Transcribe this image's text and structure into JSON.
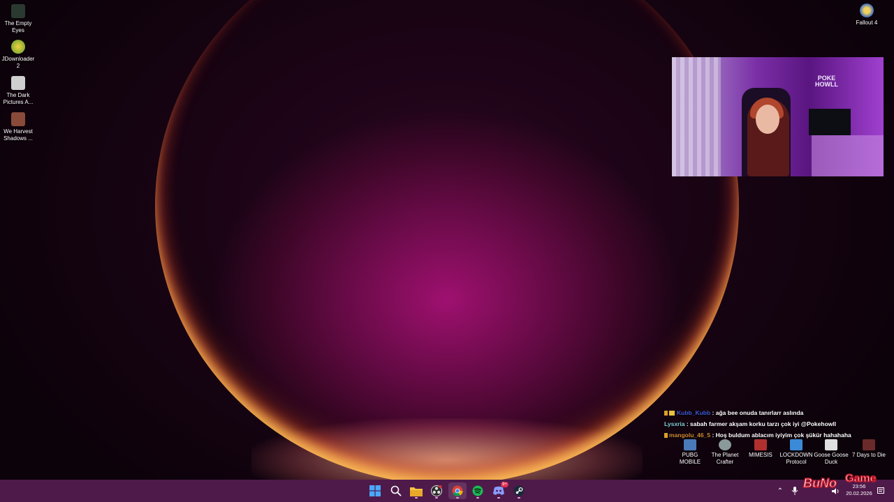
{
  "desktop": {
    "left_icons": [
      {
        "label_line1": "The Empty",
        "label_line2": "Eyes",
        "icon": "game-icon-empty-eyes",
        "color": "#2a3a30"
      },
      {
        "label_line1": "JDownloader",
        "label_line2": "2",
        "icon": "jdownloader-icon",
        "color": "#e0b020"
      },
      {
        "label_line1": "The Dark",
        "label_line2": "Pictures A...",
        "icon": "game-icon-dark-pictures",
        "color": "#cfcfcf"
      },
      {
        "label_line1": "We Harvest",
        "label_line2": "Shadows ...",
        "icon": "game-icon-we-harvest-shadows",
        "color": "#8a4a3a"
      }
    ],
    "right_icon": {
      "label": "Fallout 4",
      "icon": "fallout-4-icon",
      "color": "#3a6ac0"
    }
  },
  "webcam": {
    "sign_line1": "POKE",
    "sign_line2": "HOWLL"
  },
  "chat": {
    "messages": [
      {
        "user": "Kubb_Kubb",
        "user_color": "#3a5ad0",
        "text": ": ağa bee onuda tanırlarr aslında"
      },
      {
        "user": "Lysxria",
        "user_color": "#7fd0d8",
        "text": ": sabah farmer akşam korku tarzı çok iyi @Pokehowll"
      },
      {
        "user": "mangolu_46_5",
        "user_color": "#d08a30",
        "text": ": Hoş buldum ablacım iyiyim çok şükür hahahaha"
      }
    ]
  },
  "games": [
    {
      "line1": "PUBG",
      "line2": "MOBILE",
      "icon": "pubg-mobile-icon",
      "color": "#4a7ab8"
    },
    {
      "line1": "The Planet",
      "line2": "Crafter",
      "icon": "planet-crafter-icon",
      "color": "#8a9a9a"
    },
    {
      "line1": "MIMESIS",
      "line2": "",
      "icon": "mimesis-icon",
      "color": "#b03030"
    },
    {
      "line1": "LOCKDOWN",
      "line2": "Protocol",
      "icon": "lockdown-protocol-icon",
      "color": "#3a8ad8"
    },
    {
      "line1": "Goose Goose",
      "line2": "Duck",
      "icon": "goose-goose-duck-icon",
      "color": "#e0e0e0"
    },
    {
      "line1": "7 Days to Die",
      "line2": "",
      "icon": "7-days-to-die-icon",
      "color": "#6a2a2a"
    }
  ],
  "taskbar": {
    "apps": [
      {
        "name": "start-button",
        "glyph": "⊞",
        "color": "#4aa8ff"
      },
      {
        "name": "search-button",
        "glyph": "⌕",
        "color": "#ffffff"
      },
      {
        "name": "file-explorer-button",
        "glyph": "▰",
        "color": "#f5c542"
      },
      {
        "name": "obs-button",
        "glyph": "◉",
        "color": "#dcdcdc"
      },
      {
        "name": "chrome-button",
        "glyph": "◍",
        "color": "#e8e8e8"
      },
      {
        "name": "spotify-button",
        "glyph": "●",
        "color": "#1db954"
      },
      {
        "name": "discord-button",
        "glyph": "◆",
        "color": "#8a9cff"
      },
      {
        "name": "steam-button",
        "glyph": "◐",
        "color": "#e0e0e0"
      }
    ],
    "discord_badge": "9+",
    "time": "23:56",
    "date": "20.02.2026"
  },
  "overlay_logo": {
    "text1": "BuNo",
    "text2": "Game"
  }
}
